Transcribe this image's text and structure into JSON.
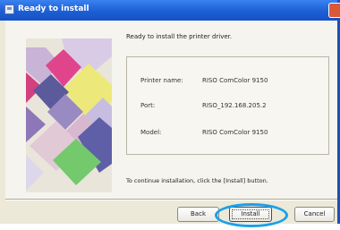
{
  "window": {
    "title": "Ready to install"
  },
  "intro_text": "Ready to install the printer driver.",
  "info": {
    "printer_name_label": "Printer name:",
    "printer_name_value": "RISO ComColor 9150",
    "port_label": "Port:",
    "port_value": "RISO_192.168.205.2",
    "model_label": "Model:",
    "model_value": "RISO ComColor 9150"
  },
  "continue_text": "To continue installation, click the [Install] button.",
  "buttons": {
    "back": "Back",
    "install": "Install",
    "cancel": "Cancel"
  },
  "colors": {
    "title_bar": "#1c5fd6",
    "highlight_ring": "#1aa0e8",
    "art_yellow": "#ece97a",
    "art_pink": "#e0458c",
    "art_purple": "#5b5a9a",
    "art_green": "#74c96d"
  }
}
